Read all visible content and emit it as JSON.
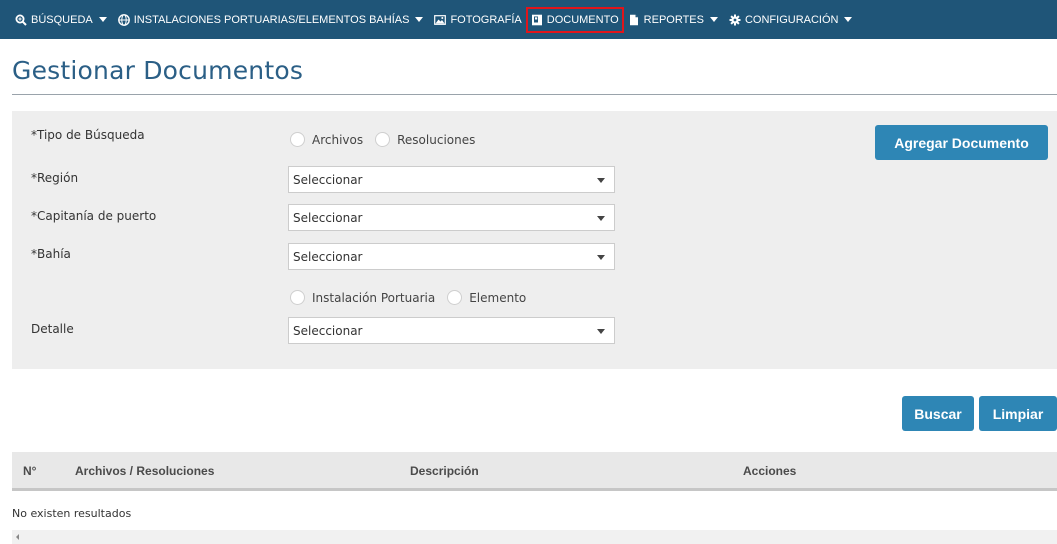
{
  "nav": {
    "items": [
      {
        "label": "BÚSQUEDA",
        "icon": "search-icon",
        "has_caret": true
      },
      {
        "label": "INSTALACIONES PORTUARIAS/ELEMENTOS BAHÍAS",
        "icon": "globe-icon",
        "has_caret": true
      },
      {
        "label": "FOTOGRAFÍA",
        "icon": "image-icon",
        "has_caret": false
      },
      {
        "label": "DOCUMENTO",
        "icon": "document-icon",
        "has_caret": false,
        "active": true
      },
      {
        "label": "REPORTES",
        "icon": "file-icon",
        "has_caret": true
      },
      {
        "label": "CONFIGURACIÓN",
        "icon": "gear-icon",
        "has_caret": true
      }
    ],
    "background": "#1f5578",
    "active_outline": "#e0151b"
  },
  "page": {
    "title": "Gestionar Documentos"
  },
  "form": {
    "tipo_busqueda_label": "*Tipo de Búsqueda",
    "tipo_options": [
      "Archivos",
      "Resoluciones"
    ],
    "region_label": "*Región",
    "region_value": "Seleccionar",
    "capitania_label": "*Capitanía de puerto",
    "capitania_value": "Seleccionar",
    "bahia_label": "*Bahía",
    "bahia_value": "Seleccionar",
    "tipo_elemento_options": [
      "Instalación Portuaria",
      "Elemento"
    ],
    "detalle_label": "Detalle",
    "detalle_value": "Seleccionar",
    "add_button": "Agregar Documento"
  },
  "actions": {
    "search_button": "Buscar",
    "clear_button": "Limpiar",
    "button_color": "#2e86b5"
  },
  "table": {
    "headers": [
      "N°",
      "Archivos / Resoluciones",
      "Descripción",
      "Acciones"
    ],
    "empty_message": "No existen resultados"
  }
}
